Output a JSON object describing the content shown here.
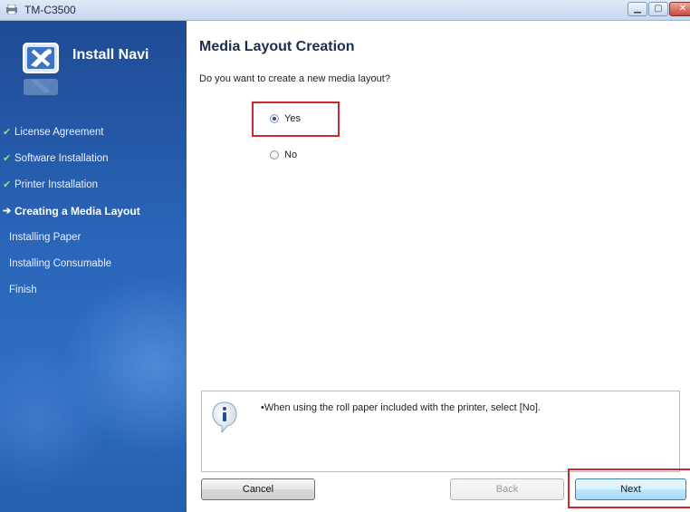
{
  "window": {
    "title": "TM-C3500",
    "controls": {
      "minimize_icon": "minimize-icon",
      "maximize_icon": "maximize-icon",
      "close_icon": "close-icon"
    }
  },
  "sidebar": {
    "brand": "Install Navi",
    "steps": [
      {
        "label": "License Agreement",
        "state": "done"
      },
      {
        "label": "Software Installation",
        "state": "done"
      },
      {
        "label": "Printer Installation",
        "state": "done"
      },
      {
        "label": "Creating a Media Layout",
        "state": "current"
      },
      {
        "label": "Installing Paper",
        "state": "pending"
      },
      {
        "label": "Installing Consumable",
        "state": "pending"
      },
      {
        "label": "Finish",
        "state": "pending"
      }
    ],
    "done_glyph": "✔",
    "current_glyph": "➔"
  },
  "main": {
    "title": "Media Layout Creation",
    "question": "Do you want to create a new media layout?",
    "options": [
      {
        "label": "Yes",
        "selected": true
      },
      {
        "label": "No",
        "selected": false
      }
    ],
    "info": {
      "icon": "info-icon",
      "text": "•When using the roll paper included with the printer, select [No]."
    }
  },
  "buttons": {
    "cancel": "Cancel",
    "back": "Back",
    "next": "Next"
  },
  "colors": {
    "highlight": "#d2262d",
    "sidebar_bg": "#2a65b8",
    "check": "#8fe36e"
  }
}
